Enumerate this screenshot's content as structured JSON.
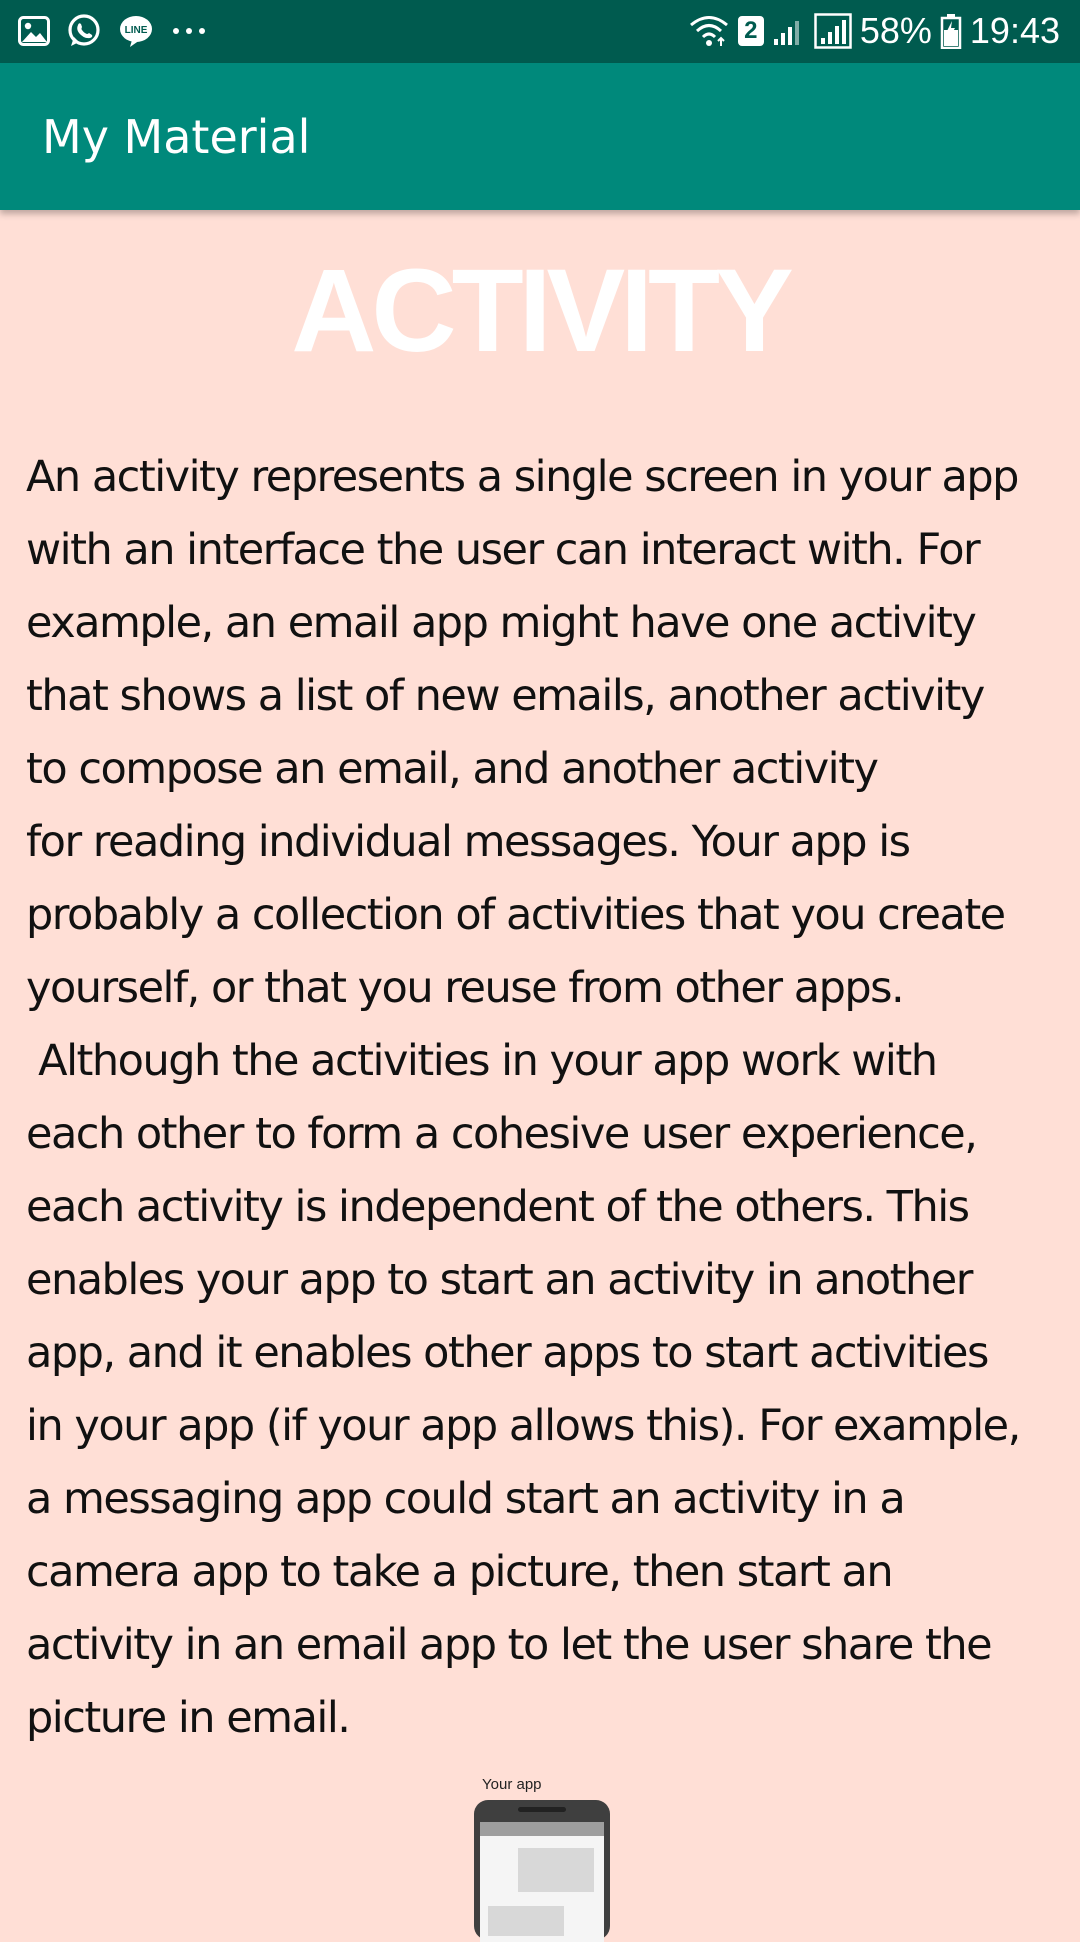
{
  "status_bar": {
    "left_icons": [
      "gallery-icon",
      "whatsapp-icon",
      "line-icon",
      "more-dots-icon"
    ],
    "wifi_badge": "2",
    "battery_percent": "58%",
    "time": "19:43",
    "colors": {
      "background": "#005b4f"
    }
  },
  "app_bar": {
    "title": "My Material",
    "colors": {
      "background": "#00897b"
    }
  },
  "content": {
    "heading": "ACTIVITY",
    "body_lines": [
      "An activity represents a single screen in your app",
      "with an interface the user can interact with. For",
      "example, an email app might have one activity",
      "that shows a list of new emails, another activity",
      "to compose an email, and another activity",
      "for reading individual messages. Your app is",
      "probably a collection of activities that you create",
      "yourself, or that you reuse from other apps.",
      " Although the activities in your app work with",
      "each other to form a cohesive user experience,",
      "each activity is independent of the others. This",
      "enables your app to start an activity in another",
      "app, and it enables other apps to start activities",
      "in your app (if your app allows this). For example,",
      "a messaging app could start an activity in a",
      "camera app to take a picture, then start an",
      "activity in an email app to let the user share the",
      "picture in email."
    ],
    "illustration_label": "Your app",
    "colors": {
      "background": "#ffdfd6",
      "heading": "#ffffff"
    }
  }
}
